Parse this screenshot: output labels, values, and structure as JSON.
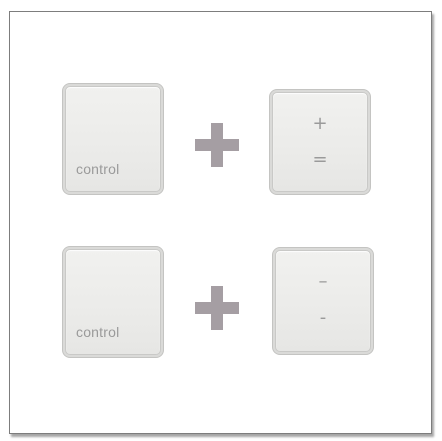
{
  "row1": {
    "left_key_label": "control",
    "right_key_top": "+",
    "right_key_bottom": "="
  },
  "row2": {
    "left_key_label": "control",
    "right_key_top": "–",
    "right_key_bottom": "-"
  },
  "colors": {
    "plus_sign": "#a59ea3",
    "key_face": "#ebebe9",
    "key_text": "#9a9a9a",
    "frame_border": "#7d7d7d"
  }
}
